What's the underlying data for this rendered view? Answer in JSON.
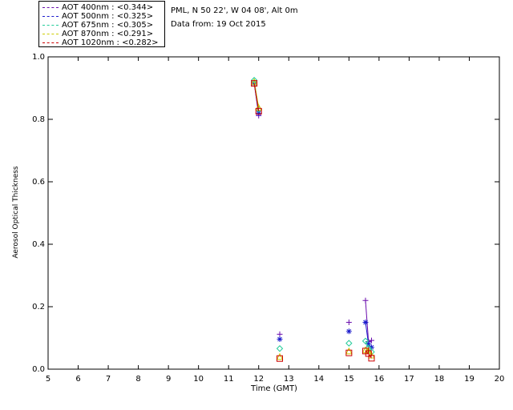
{
  "header": {
    "location": "PML, N 50 22', W 04 08', Alt 0m",
    "date_line": "Data from: 19 Oct 2015"
  },
  "chart_data": {
    "type": "scatter",
    "title": "",
    "xlabel": "Time (GMT)",
    "ylabel": "Aerosol Optical Thickness",
    "xlim": [
      5,
      20
    ],
    "ylim": [
      0,
      1.0
    ],
    "xticks": [
      5,
      6,
      7,
      8,
      9,
      10,
      11,
      12,
      13,
      14,
      15,
      16,
      17,
      18,
      19,
      20
    ],
    "yticks": [
      0.0,
      0.2,
      0.4,
      0.6,
      0.8,
      1.0
    ],
    "ytick_labels": [
      "0.0",
      "0.2",
      "0.4",
      "0.6",
      "0.8",
      "1.0"
    ],
    "grid": false,
    "legend_position": "top-left, above plot",
    "series": [
      {
        "name": "AOT  400nm : <0.344>",
        "color": "#6a0dad",
        "marker": "plus",
        "points": [
          [
            11.85,
            0.918
          ],
          [
            12.0,
            0.812
          ],
          [
            12.7,
            0.112
          ],
          [
            15.0,
            0.15
          ],
          [
            15.55,
            0.22
          ],
          [
            15.65,
            0.088
          ],
          [
            15.75,
            0.092
          ]
        ]
      },
      {
        "name": "AOT  500nm : <0.325>",
        "color": "#1a1acc",
        "marker": "asterisk",
        "points": [
          [
            11.85,
            0.915
          ],
          [
            12.0,
            0.82
          ],
          [
            12.7,
            0.096
          ],
          [
            15.0,
            0.121
          ],
          [
            15.55,
            0.15
          ],
          [
            15.65,
            0.08
          ],
          [
            15.75,
            0.07
          ]
        ]
      },
      {
        "name": "AOT  675nm : <0.305>",
        "color": "#22cc99",
        "marker": "diamond",
        "points": [
          [
            11.85,
            0.925
          ],
          [
            12.0,
            0.832
          ],
          [
            12.7,
            0.066
          ],
          [
            15.0,
            0.083
          ],
          [
            15.55,
            0.09
          ],
          [
            15.65,
            0.068
          ],
          [
            15.75,
            0.055
          ]
        ]
      },
      {
        "name": "AOT  870nm : <0.291>",
        "color": "#cccc00",
        "marker": "triangle",
        "points": [
          [
            11.85,
            0.92
          ],
          [
            12.0,
            0.838
          ],
          [
            12.7,
            0.04
          ],
          [
            15.0,
            0.058
          ],
          [
            15.55,
            0.062
          ],
          [
            15.65,
            0.06
          ],
          [
            15.75,
            0.045
          ]
        ]
      },
      {
        "name": "AOT 1020nm : <0.282>",
        "color": "#cc0000",
        "marker": "square",
        "points": [
          [
            11.85,
            0.915
          ],
          [
            12.0,
            0.826
          ],
          [
            12.7,
            0.034
          ],
          [
            15.0,
            0.052
          ],
          [
            15.55,
            0.058
          ],
          [
            15.65,
            0.05
          ],
          [
            15.75,
            0.035
          ]
        ]
      }
    ]
  }
}
